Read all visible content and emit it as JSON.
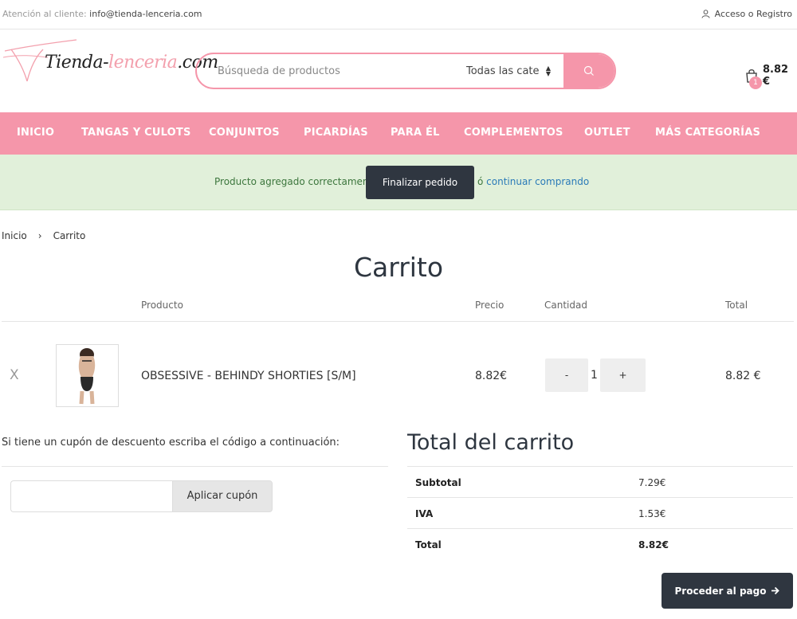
{
  "topbar": {
    "contact_label": "Atención al cliente:",
    "contact_email": "info@tienda-lenceria.com",
    "account_label": "Acceso o Registro"
  },
  "header": {
    "logo_text_a": "Tienda-",
    "logo_text_b": "lenceria",
    "logo_text_c": ".com",
    "search_placeholder": "Búsqueda de productos",
    "category_selected": "Todas las categorías",
    "cart_count": "1",
    "cart_amount": "8.82 €"
  },
  "nav": {
    "items": [
      "INICIO",
      "TANGAS Y CULOTS",
      "CONJUNTOS",
      "PICARDÍAS",
      "PARA ÉL",
      "COMPLEMENTOS",
      "OUTLET",
      "MÁS CATEGORÍAS"
    ]
  },
  "notice": {
    "message": "Producto agregado correctamente",
    "finish_label": "Finalizar pedido",
    "or_text": "ó",
    "continue_label": "continuar comprando"
  },
  "breadcrumb": {
    "home": "Inicio",
    "separator": "›",
    "current": "Carrito"
  },
  "page_title": "Carrito",
  "table": {
    "headers": {
      "product": "Producto",
      "price": "Precio",
      "quantity": "Cantidad",
      "total": "Total"
    },
    "rows": [
      {
        "remove": "X",
        "name": "OBSESSIVE - BEHINDY SHORTIES [S/M]",
        "price": "8.82€",
        "minus": "-",
        "qty": "1",
        "plus": "+",
        "total": "8.82 €"
      }
    ]
  },
  "coupon": {
    "label": "Si tiene un cupón de descuento escriba el código a continuación:",
    "input_value": "",
    "button": "Aplicar cupón"
  },
  "totals": {
    "title": "Total del carrito",
    "subtotal_label": "Subtotal",
    "subtotal_value": "7.29€",
    "tax_label": "IVA",
    "tax_value": "1.53€",
    "total_label": "Total",
    "total_value": "8.82€",
    "proceed_label": "Proceder al pago"
  },
  "colors": {
    "brand_pink": "#f596aa",
    "dark_button": "#2f3640",
    "notice_bg": "#e1f0da",
    "notice_text": "#3c763d",
    "link_blue": "#2a7ab8"
  },
  "icons": {
    "account": "user-icon",
    "search": "search-icon",
    "cart": "shopping-bag-icon",
    "proceed": "arrow-right-icon",
    "select": "select-arrows-icon"
  }
}
